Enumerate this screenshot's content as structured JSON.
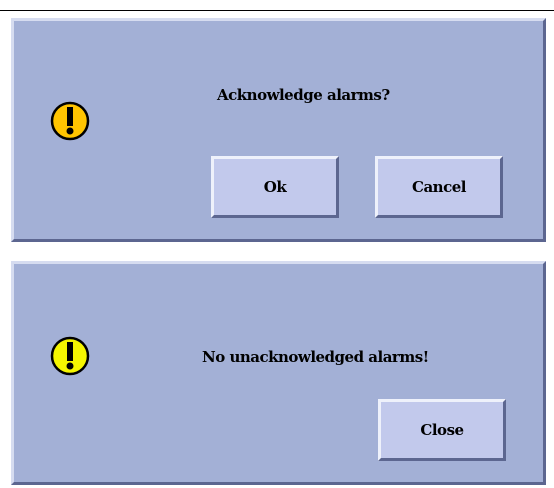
{
  "dialogs": {
    "acknowledge": {
      "message": "Acknowledge alarms?",
      "ok_label": "Ok",
      "cancel_label": "Cancel",
      "icon": "warning-exclamation-icon",
      "icon_color": "#ffc400"
    },
    "no_alarms": {
      "message": "No unacknowledged alarms!",
      "close_label": "Close",
      "icon": "warning-exclamation-icon",
      "icon_color": "#f5f500"
    }
  },
  "colors": {
    "dialog_bg": "#a3b0d6",
    "button_bg": "#c2c9ec"
  }
}
